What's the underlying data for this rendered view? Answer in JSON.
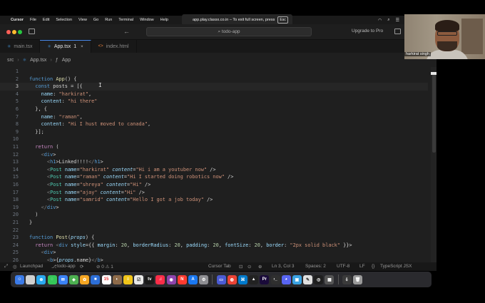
{
  "menubar": {
    "app": "Cursor",
    "items": [
      "File",
      "Edit",
      "Selection",
      "View",
      "Go",
      "Run",
      "Terminal",
      "Window",
      "Help"
    ]
  },
  "notice": {
    "text": "app.play.classx.co.in – To exit full screen, press",
    "key": "Esc"
  },
  "titlebar": {
    "search": "todo-app",
    "upgrade": "Upgrade to Pro"
  },
  "tabs": [
    {
      "label": "main.tsx",
      "icon": "typescript-icon",
      "active": false
    },
    {
      "label": "App.tsx",
      "badge": "1",
      "icon": "typescript-icon",
      "active": true
    },
    {
      "label": "index.html",
      "icon": "html-icon",
      "active": false
    }
  ],
  "breadcrumb": {
    "folder": "src",
    "file": "App.tsx",
    "symbol": "App"
  },
  "editor": {
    "current_line": 3,
    "lines": [
      "",
      "function App() {",
      "  const posts = [{",
      "    name: \"harkirat\",",
      "    content: \"hi there\"",
      "  }, {",
      "    name: \"raman\",",
      "    content: \"Hi I hust moved to canada\",",
      "  }];",
      "",
      "  return (",
      "    <div>",
      "      <h1>Linked!!!!</h1>",
      "      <Post name=\"harkirat\" content=\"Hi i am a youtuber now\" />",
      "      <Post name=\"raman\" content=\"Hi I started doing robotics now\" />",
      "      <Post name=\"shreya\" content=\"Hi\" />",
      "      <Post name=\"ajay\" content=\"Hi\" />",
      "      <Post name=\"samrid\" content=\"Hello I got a job today\" />",
      "    </div>",
      "  )",
      "}",
      "",
      "function Post(props) {",
      "  return <div style={{ margin: 20, borderRadius: 20, padding: 20, fontSize: 20, border: \"2px solid black\" }}>",
      "    <div>",
      "      <b>{props.name}</b>"
    ]
  },
  "statusbar": {
    "launchpad": "Launchpad",
    "branch": "todo-app",
    "problems": "⊘ 0 ⚠ 1",
    "cursor_tab": "Cursor Tab",
    "position": "Ln 3, Col 3",
    "spaces": "Spaces: 2",
    "encoding": "UTF-8",
    "eol": "LF",
    "language": "TypeScript JSX"
  },
  "webcam": {
    "name": "harkirat singh"
  },
  "colors": {
    "accent": "#4a8cf0",
    "editor_bg": "#1f1f1f",
    "keyword": "#569cd6",
    "string": "#ce9178"
  }
}
